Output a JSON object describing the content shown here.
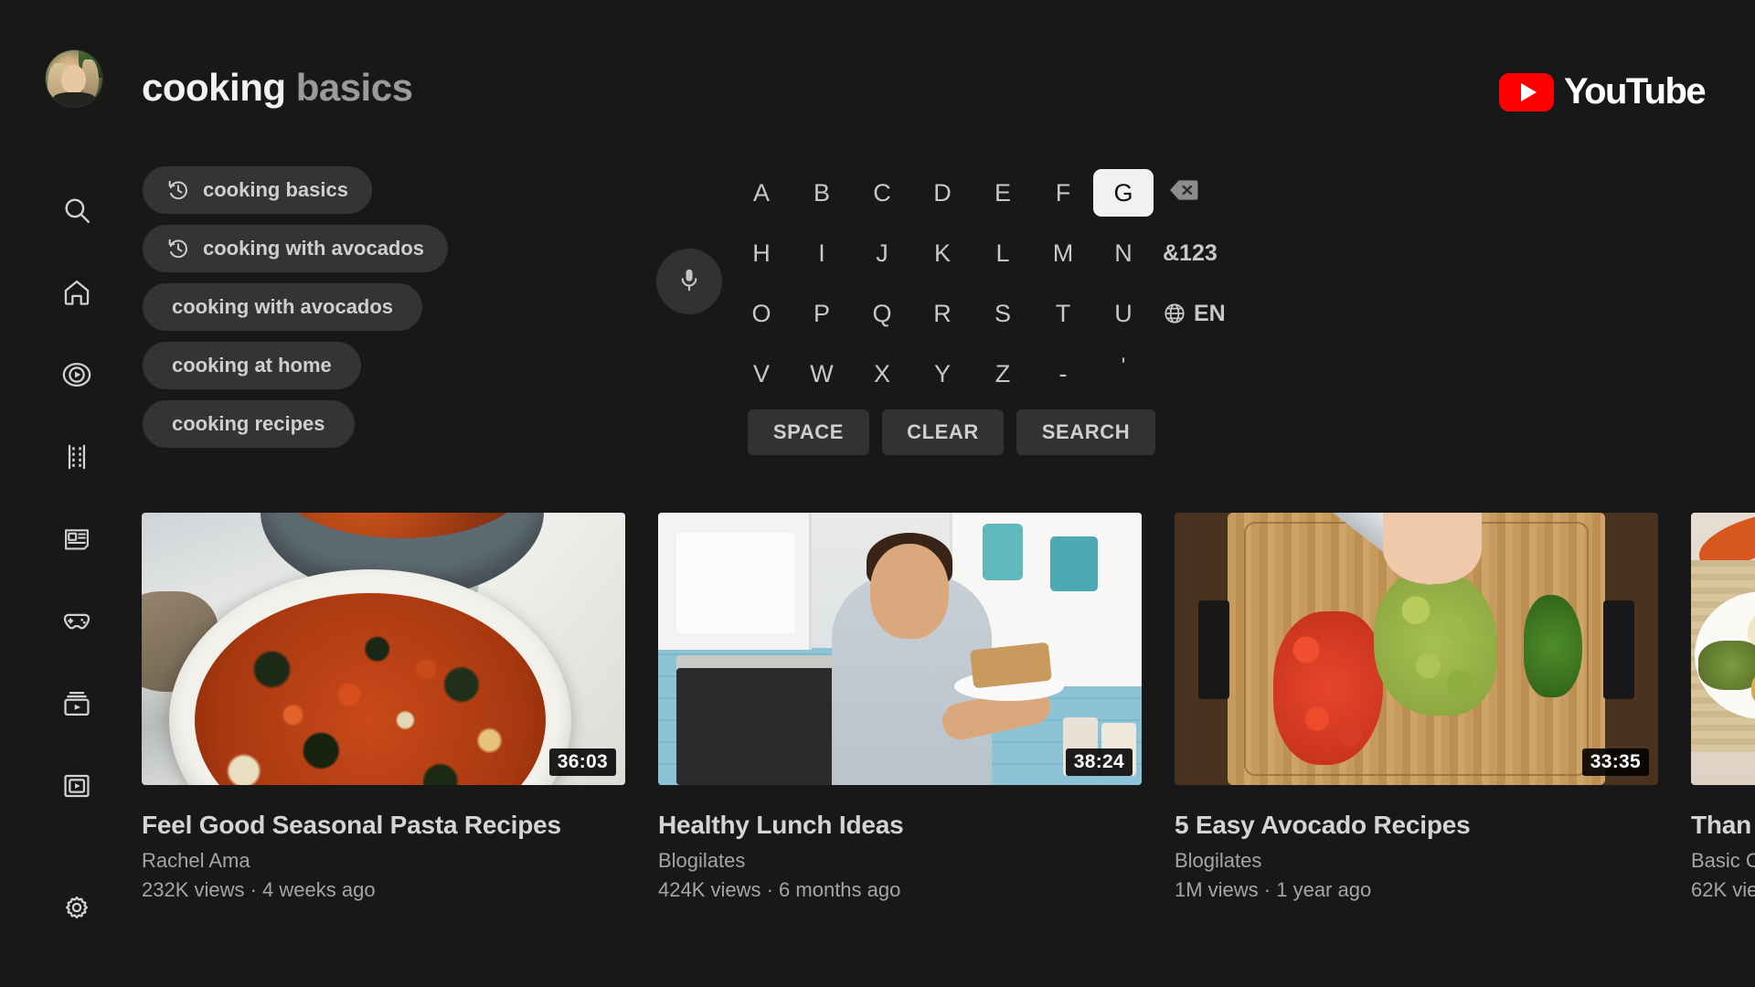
{
  "app": {
    "name": "YouTube",
    "logo_color": "#ff0000"
  },
  "header": {
    "query_typed": "cooking",
    "query_suggestion": "basics",
    "avatar_name": "profile-avatar"
  },
  "sidebar": {
    "items": [
      {
        "id": "search",
        "icon": "search-icon",
        "label": "Search"
      },
      {
        "id": "home",
        "icon": "home-icon",
        "label": "Home"
      },
      {
        "id": "shorts",
        "icon": "shorts-icon",
        "label": "Shorts"
      },
      {
        "id": "movies",
        "icon": "film-strip-icon",
        "label": "Movies"
      },
      {
        "id": "news",
        "icon": "news-icon",
        "label": "News"
      },
      {
        "id": "gaming",
        "icon": "gamepad-icon",
        "label": "Gaming"
      },
      {
        "id": "subscriptions",
        "icon": "subscriptions-icon",
        "label": "Subscriptions"
      },
      {
        "id": "library",
        "icon": "library-icon",
        "label": "Library"
      }
    ],
    "settings": {
      "icon": "gear-icon",
      "label": "Settings"
    }
  },
  "suggestions": [
    {
      "text": "cooking basics",
      "history": true,
      "icon": "history-icon"
    },
    {
      "text": "cooking with avocados",
      "history": true,
      "icon": "history-icon"
    },
    {
      "text": "cooking with avocados",
      "history": false,
      "icon": ""
    },
    {
      "text": "cooking at home",
      "history": false,
      "icon": ""
    },
    {
      "text": "cooking recipes",
      "history": false,
      "icon": ""
    }
  ],
  "keyboard": {
    "mic": {
      "icon": "microphone-icon",
      "label": "Voice search"
    },
    "rows": [
      [
        "A",
        "B",
        "C",
        "D",
        "E",
        "F",
        "G"
      ],
      [
        "H",
        "I",
        "J",
        "K",
        "L",
        "M",
        "N"
      ],
      [
        "O",
        "P",
        "Q",
        "R",
        "S",
        "T",
        "U"
      ],
      [
        "V",
        "W",
        "X",
        "Y",
        "Z",
        "-",
        "'"
      ]
    ],
    "selected_key": "G",
    "backspace": {
      "icon": "backspace-icon",
      "label": "Backspace"
    },
    "symbols_key": "&123",
    "language_key": {
      "icon": "globe-icon",
      "label": "EN"
    },
    "actions": [
      {
        "id": "space",
        "label": "SPACE"
      },
      {
        "id": "clear",
        "label": "CLEAR"
      },
      {
        "id": "search",
        "label": "SEARCH"
      }
    ]
  },
  "results": [
    {
      "title": "Feel Good Seasonal Pasta Recipes",
      "channel": "Rachel Ama",
      "meta": "232K views · 4 weeks ago",
      "duration": "36:03",
      "thumb": "pasta-bowl-thumbnail"
    },
    {
      "title": "Healthy Lunch Ideas",
      "channel": "Blogilates",
      "meta": "424K views · 6 months ago",
      "duration": "38:24",
      "thumb": "kitchen-sandwich-thumbnail"
    },
    {
      "title": "5 Easy Avocado Recipes",
      "channel": "Blogilates",
      "meta": "1M views · 1 year ago",
      "duration": "33:35",
      "thumb": "cutting-board-thumbnail"
    },
    {
      "title": "Than",
      "channel": "Basic C",
      "meta": "62K vie",
      "duration": "",
      "thumb": "thanksgiving-plate-thumbnail"
    }
  ],
  "colors": {
    "background": "#181818",
    "chip": "#343434",
    "key_selected_bg": "#f1f1f1",
    "text_primary": "#f2f2f2",
    "text_secondary": "#a5a5a5"
  }
}
